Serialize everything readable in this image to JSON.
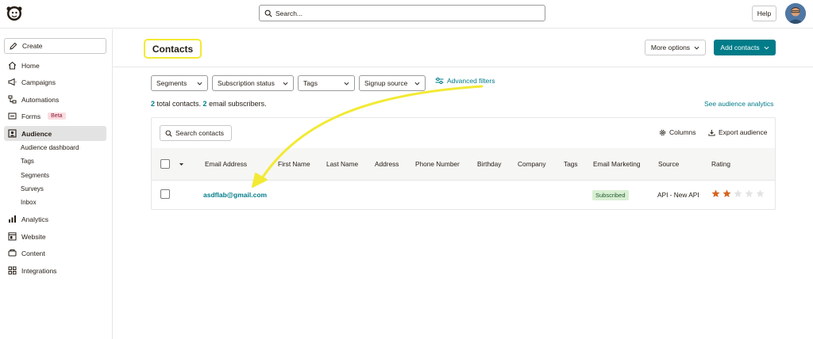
{
  "header": {
    "search_placeholder": "Search...",
    "help_label": "Help"
  },
  "sidebar": {
    "create_label": "Create",
    "items": [
      {
        "label": "Home",
        "icon": "home-icon"
      },
      {
        "label": "Campaigns",
        "icon": "megaphone-icon"
      },
      {
        "label": "Automations",
        "icon": "automation-icon"
      },
      {
        "label": "Forms",
        "icon": "form-icon",
        "badge": "Beta"
      },
      {
        "label": "Audience",
        "icon": "audience-icon",
        "active": true
      },
      {
        "label": "Analytics",
        "icon": "analytics-icon"
      },
      {
        "label": "Website",
        "icon": "website-icon"
      },
      {
        "label": "Content",
        "icon": "content-icon"
      },
      {
        "label": "Integrations",
        "icon": "integrations-icon"
      }
    ],
    "audience_sub": [
      "Audience dashboard",
      "Tags",
      "Segments",
      "Surveys",
      "Inbox"
    ]
  },
  "main": {
    "title": "Contacts",
    "more_options": "More options",
    "add_contacts": "Add contacts",
    "filters": [
      "Segments",
      "Subscription status",
      "Tags",
      "Signup source"
    ],
    "advanced_filters": "Advanced filters",
    "summary": {
      "total_count": "2",
      "total_text": " total contacts. ",
      "email_count": "2",
      "email_text": " email subscribers."
    },
    "analytics_link": "See audience analytics",
    "table": {
      "search_label": "Search contacts",
      "columns_label": "Columns",
      "export_label": "Export audience",
      "headers": [
        "Email Address",
        "First Name",
        "Last Name",
        "Address",
        "Phone Number",
        "Birthday",
        "Company",
        "Tags",
        "Email Marketing",
        "Source",
        "Rating"
      ],
      "rows": [
        {
          "email": "asdflab@gmail.com",
          "status": "Subscribed",
          "source": "API - New API",
          "rating": 2,
          "rating_max": 5
        }
      ]
    }
  },
  "colors": {
    "accent": "#007c89",
    "highlight": "#f2ea34",
    "star": "#d3651f"
  }
}
